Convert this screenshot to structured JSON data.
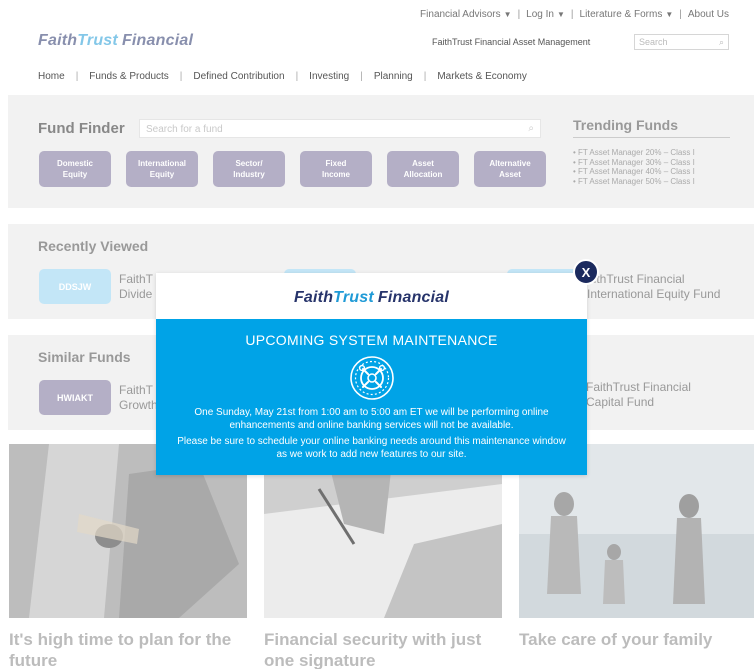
{
  "utility_nav": {
    "advisors": "Financial Advisors",
    "login": "Log In",
    "literature": "Literature & Forms",
    "about": "About Us"
  },
  "brand": {
    "faith": "Faith",
    "trust": "Trust",
    "financial": "Financial"
  },
  "asset_management_link": "FaithTrust Financial Asset Management",
  "top_search": {
    "placeholder": "Search"
  },
  "main_nav": [
    "Home",
    "Funds & Products",
    "Defined Contribution",
    "Investing",
    "Planning",
    "Markets & Economy"
  ],
  "fund_finder": {
    "title": "Fund Finder",
    "search_placeholder": "Search for a fund",
    "categories": [
      [
        "Domestic",
        "Equity"
      ],
      [
        "International",
        "Equity"
      ],
      [
        "Sector/",
        "Industry"
      ],
      [
        "Fixed",
        "Income"
      ],
      [
        "Asset",
        "Allocation"
      ],
      [
        "Alternative",
        "Asset"
      ]
    ]
  },
  "trending": {
    "title": "Trending Funds",
    "items": [
      "• FT Asset Manager 20% – Class I",
      "• FT Asset Manager 30% – Class I",
      "• FT Asset Manager 40% – Class I",
      "• FT Asset Manager 50% – Class I"
    ]
  },
  "recently_viewed": {
    "title": "Recently Viewed",
    "cards": [
      {
        "ticker": "DDSJW",
        "name_line1": "FaithT",
        "name_line2": "Divide"
      },
      {
        "ticker": "",
        "name_line1": "",
        "name_line2": ""
      },
      {
        "ticker": "",
        "name_line1": "aithTrust Financial",
        "name_line2": "International Equity Fund"
      }
    ]
  },
  "similar_funds": {
    "title": "Similar Funds",
    "cards": [
      {
        "ticker": "HWIAKT",
        "name_line1": "FaithT",
        "name_line2": "Growth"
      },
      {
        "ticker": "",
        "name_line1": "FaithTrust Financial",
        "name_line2": "Capital Fund"
      }
    ]
  },
  "promos": [
    {
      "line1": "It's high time to plan for the",
      "line2": "future"
    },
    {
      "line1": "Financial security with just",
      "line2": "one signature"
    },
    {
      "line1": "Take care of your family",
      "line2": ""
    }
  ],
  "modal": {
    "heading": "UPCOMING SYSTEM MAINTENANCE",
    "message1": "One Sunday, May 21st from 1:00 am to 5:00 am ET we will be performing online enhancements and online banking services will not be available.",
    "message2": "Please be sure to schedule your online banking needs around this maintenance window as we work to add new features to our site.",
    "close_label": "X",
    "icon": "gear-wrench-icon"
  },
  "colors": {
    "navy": "#27346b",
    "brand_blue": "#1f9ad6",
    "modal_blue": "#00a3e7",
    "close_navy": "#1b2a5e",
    "category_purple": "#b4afc6",
    "ticker_light_blue": "#c3e6f7"
  }
}
